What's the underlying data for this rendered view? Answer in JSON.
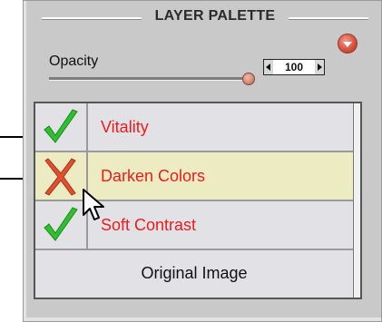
{
  "palette": {
    "title": "LAYER PALETTE"
  },
  "opacity": {
    "label": "Opacity",
    "value": "100",
    "slider_fraction": 1.0
  },
  "layers": [
    {
      "name": "Vitality",
      "state": "visible",
      "icon": "checkmark-icon"
    },
    {
      "name": "Darken Colors",
      "state": "hidden",
      "icon": "x-mark-icon",
      "selected": true
    },
    {
      "name": "Soft Contrast",
      "state": "visible",
      "icon": "checkmark-icon"
    }
  ],
  "base_layer": {
    "name": "Original Image"
  },
  "colors": {
    "layer_name": "#ec1c1c",
    "selected_row": "#ecebc2",
    "check_green": "#2fbf2f",
    "x_red": "#e0502f"
  }
}
